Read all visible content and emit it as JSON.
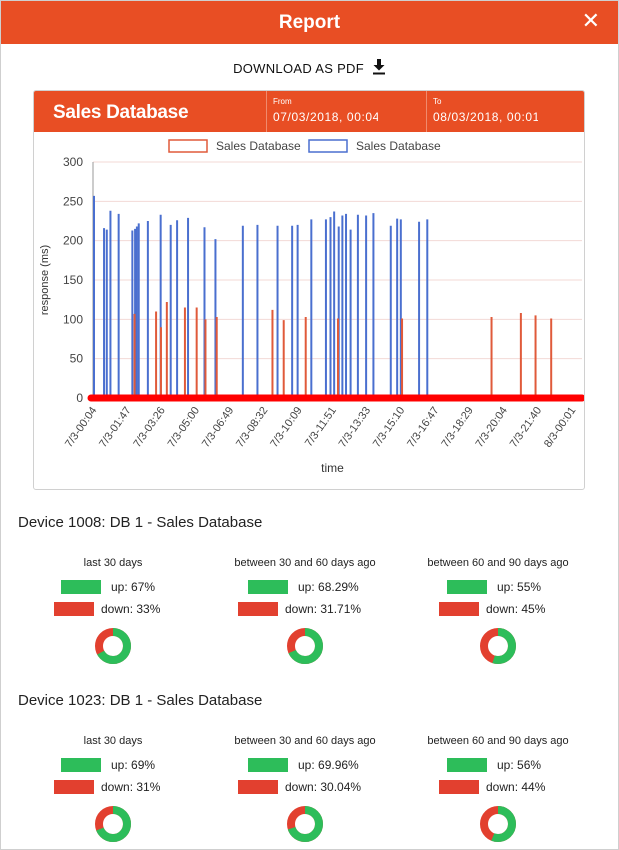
{
  "modal": {
    "title": "Report",
    "close": "✕"
  },
  "download": {
    "label": "DOWNLOAD AS PDF"
  },
  "panel": {
    "name": "Sales Database",
    "from_label": "From",
    "from_value": "07/03/2018, 00:04",
    "to_label": "To",
    "to_value": "08/03/2018, 00:01"
  },
  "colors": {
    "accent": "#e84e24",
    "up": "#2dbd5a",
    "down": "#e2402f",
    "series_red": "#e05a3a",
    "series_blue": "#4a6fcf"
  },
  "chart_data": {
    "type": "bar",
    "legend": [
      "Sales Database",
      "Sales Database"
    ],
    "xlabel": "time",
    "ylabel": "response (ms)",
    "ylim": [
      0,
      300
    ],
    "yticks": [
      0,
      50,
      100,
      150,
      200,
      250,
      300
    ],
    "xtick_labels": [
      "7/3-00:04",
      "7/3-01:47",
      "7/3-03:26",
      "7/3-05:00",
      "7/3-06:49",
      "7/3-08:32",
      "7/3-10:09",
      "7/3-11:51",
      "7/3-13:33",
      "7/3-15:10",
      "7/3-16:47",
      "7/3-18:29",
      "7/3-20:04",
      "7/3-21:40",
      "8/3-00:01"
    ],
    "series": [
      {
        "name": "Sales Database",
        "color": "#e05a3a",
        "points": [
          [
            0.027,
            107
          ],
          [
            0.041,
            110
          ],
          [
            0.045,
            90
          ],
          [
            0.052,
            122
          ],
          [
            0.063,
            106
          ],
          [
            0.067,
            115
          ],
          [
            0.075,
            118
          ],
          [
            0.086,
            100
          ],
          [
            0.118,
            112
          ],
          [
            0.134,
            98
          ],
          [
            0.148,
            103
          ],
          [
            0.175,
            103
          ],
          [
            0.201,
            102
          ],
          [
            0.247,
            101
          ],
          [
            0.261,
            108
          ],
          [
            0.275,
            105
          ],
          [
            0.285,
            101
          ]
        ],
        "x_domain": "fraction"
      },
      {
        "name": "Sales Database",
        "color": "#4a6fcf",
        "points": []
      }
    ]
  },
  "devices": [
    {
      "title": "Device 1008: DB 1 - Sales Database",
      "periods": [
        {
          "label": "last 30 days",
          "up_text": "up: 67%",
          "down_text": "down: 33%",
          "up": 0.67
        },
        {
          "label": "between 30 and 60 days ago",
          "up_text": "up: 68.29%",
          "down_text": "down: 31.71%",
          "up": 0.6829
        },
        {
          "label": "between 60 and 90 days ago",
          "up_text": "up: 55%",
          "down_text": "down: 45%",
          "up": 0.55
        }
      ]
    },
    {
      "title": "Device 1023: DB 1 - Sales Database",
      "periods": [
        {
          "label": "last 30 days",
          "up_text": "up: 69%",
          "down_text": "down: 31%",
          "up": 0.69
        },
        {
          "label": "between 30 and 60 days ago",
          "up_text": "up: 69.96%",
          "down_text": "down: 30.04%",
          "up": 0.6996
        },
        {
          "label": "between 60 and 90 days ago",
          "up_text": "up: 56%",
          "down_text": "down: 44%",
          "up": 0.56
        }
      ]
    }
  ]
}
